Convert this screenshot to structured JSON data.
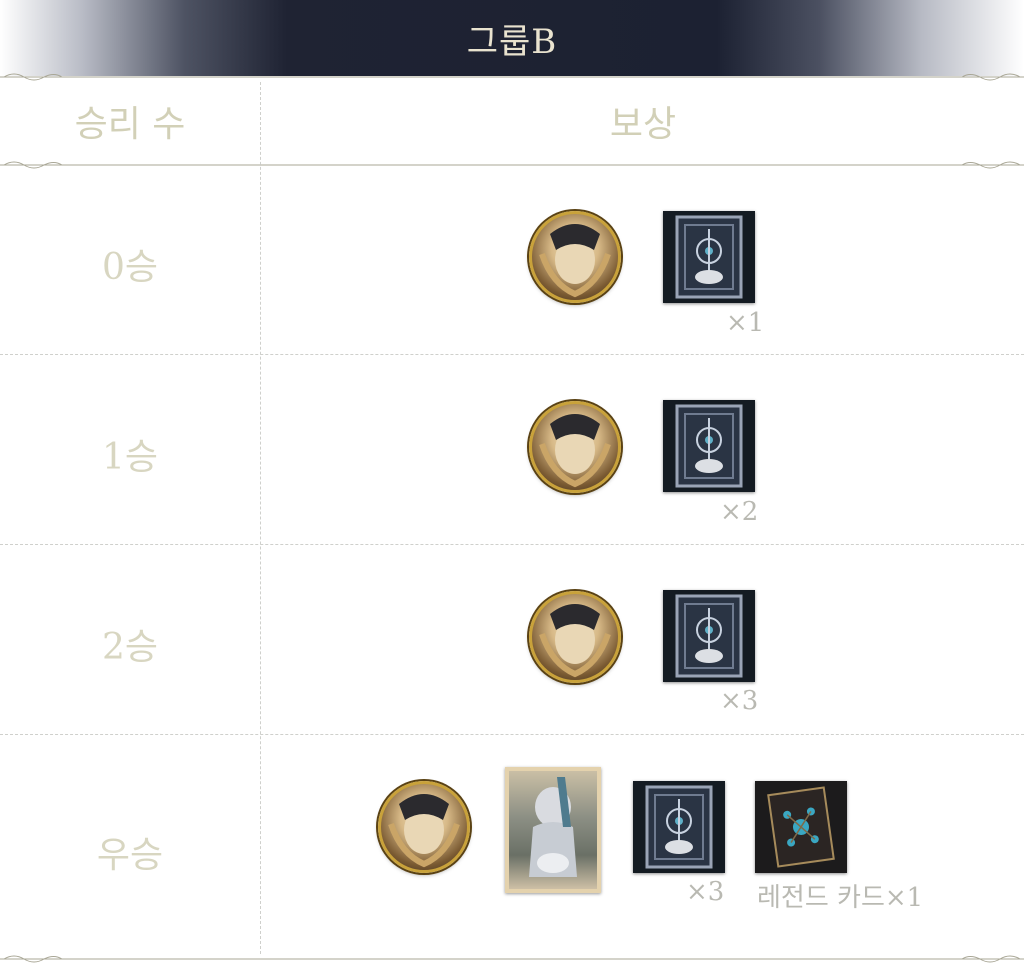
{
  "group_title": "그룹B",
  "headers": {
    "wins": "승리 수",
    "reward": "보상"
  },
  "rows": [
    {
      "label": "0승",
      "tier_card_qty": "×1"
    },
    {
      "label": "1승",
      "tier_card_qty": "×2"
    },
    {
      "label": "2승",
      "tier_card_qty": "×3"
    },
    {
      "label": "우승",
      "tier_card_qty": "×3",
      "legend_card_qty": "레전드 카드×1"
    }
  ],
  "colors": {
    "banner_dark": "#1c2132",
    "banner_text": "#e9e3cf",
    "label_text": "#d8d6c1",
    "qty_text": "#b9b9b2",
    "medal_gold": "#c9a23a"
  },
  "icons": {
    "medal": "character-medal-icon",
    "tier_card": "ornate-card-back-icon",
    "portrait": "character-portrait-card-icon",
    "legend_card": "legend-card-back-icon"
  }
}
